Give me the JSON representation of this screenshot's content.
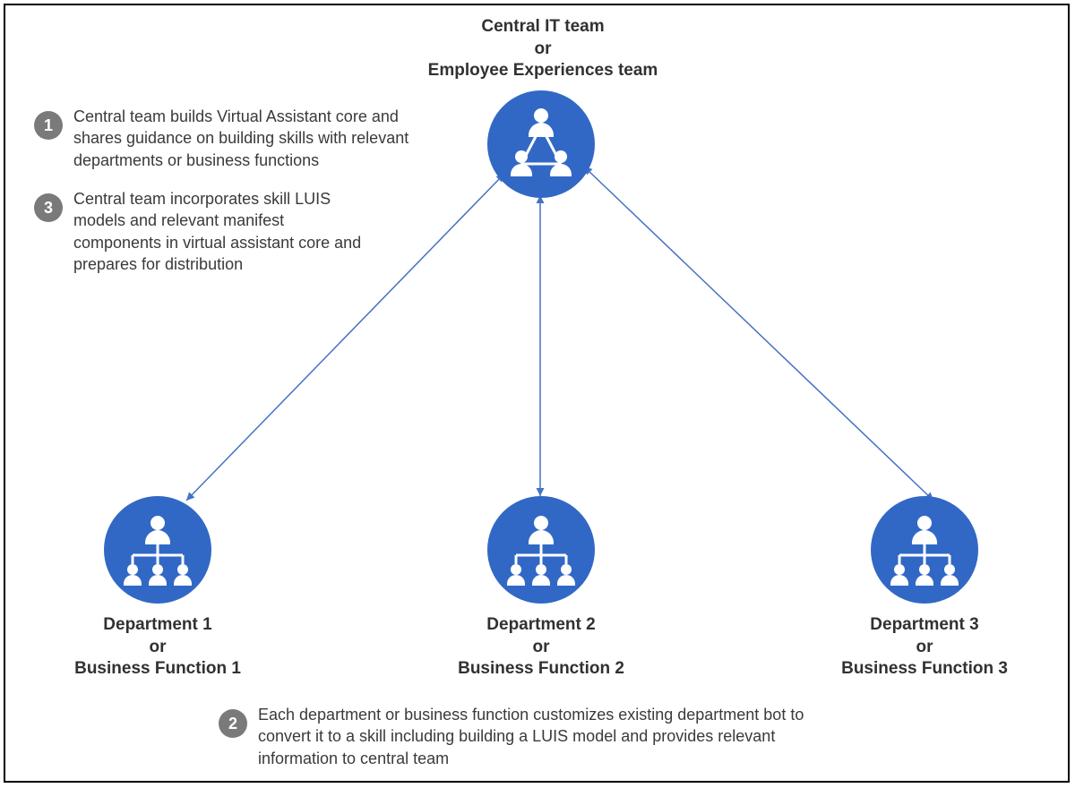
{
  "central": {
    "line1": "Central IT team",
    "or": "or",
    "line2": "Employee Experiences team"
  },
  "departments": [
    {
      "name": "Department 1",
      "or": "or",
      "fn": "Business Function 1"
    },
    {
      "name": "Department 2",
      "or": "or",
      "fn": "Business Function 2"
    },
    {
      "name": "Department 3",
      "or": "or",
      "fn": "Business Function 3"
    }
  ],
  "steps": {
    "s1": {
      "num": "1",
      "text": "Central team builds Virtual Assistant core and shares guidance on building skills with relevant departments or business functions"
    },
    "s3": {
      "num": "3",
      "text": "Central team incorporates skill LUIS models and relevant manifest components in virtual assistant core and prepares for distribution"
    },
    "s2": {
      "num": "2",
      "text": "Each department or business function customizes existing department bot to convert it to a skill including building a LUIS model and provides relevant information to central team"
    }
  },
  "colors": {
    "node": "#3268c5",
    "line": "#4472c4",
    "badge": "#7a7a7a"
  }
}
